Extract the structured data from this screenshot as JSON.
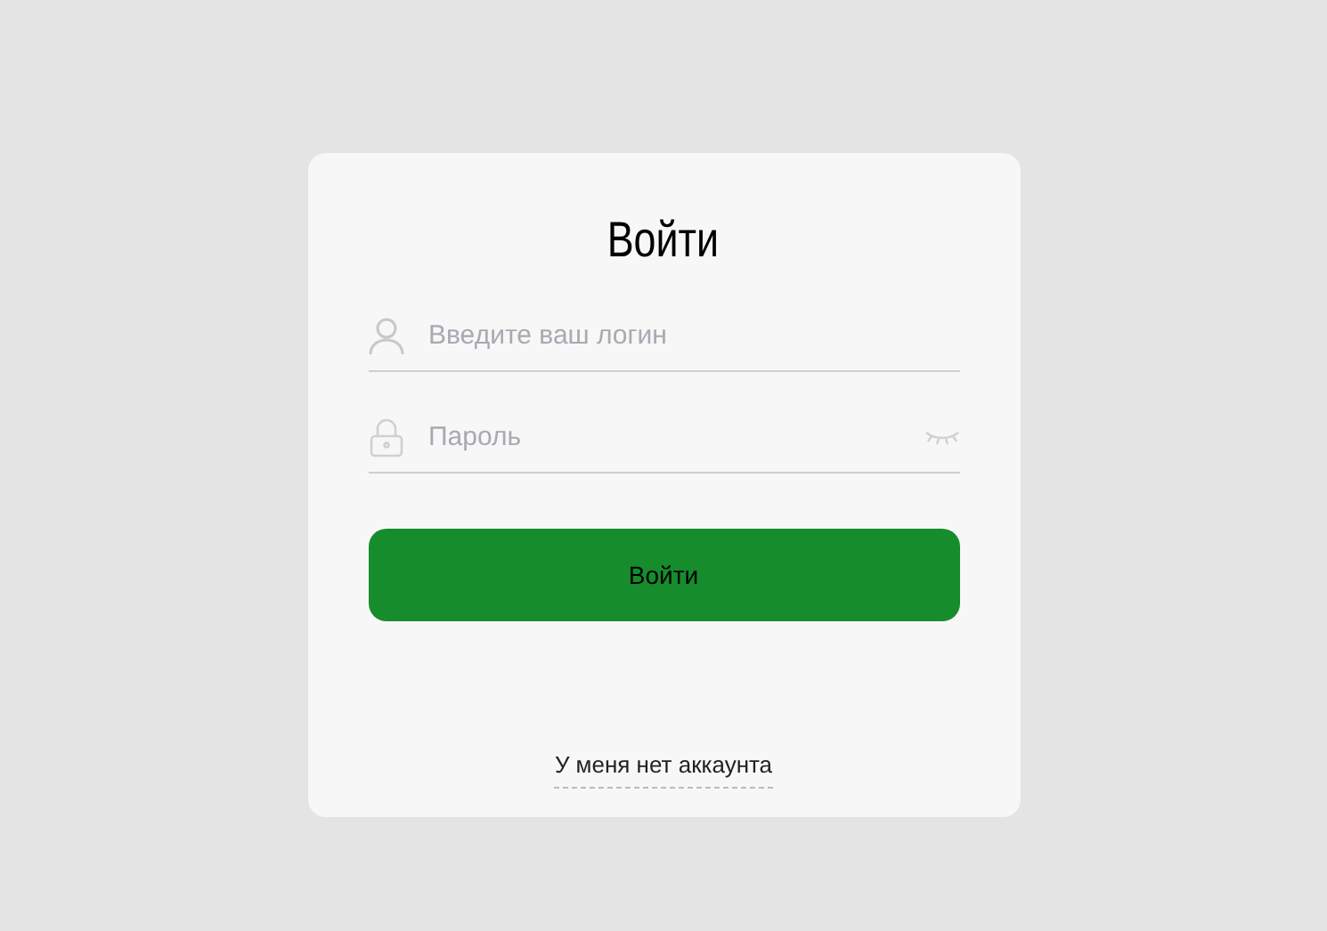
{
  "title": "Войти",
  "fields": [
    {
      "kind": "login",
      "placeholder": "Введите ваш логин"
    },
    {
      "kind": "password",
      "placeholder": "Пароль"
    }
  ],
  "submit": "Войти",
  "link": "У меня нет аккаунта"
}
